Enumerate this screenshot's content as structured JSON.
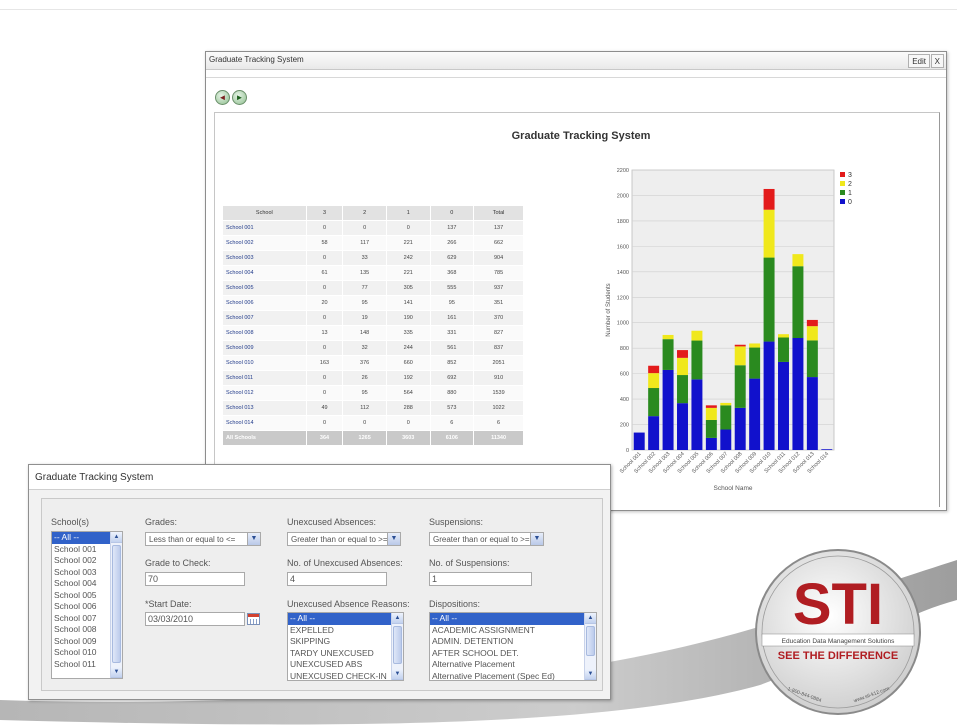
{
  "window": {
    "title": "Graduate Tracking System",
    "edit_label": "Edit",
    "close_label": "X",
    "report_title": "Graduate Tracking System"
  },
  "toolbar": {
    "icon_a": "search-back-icon",
    "icon_b": "search-export-icon"
  },
  "table": {
    "headers": [
      "School",
      "3",
      "2",
      "1",
      "0",
      "Total"
    ],
    "rows": [
      [
        "School 001",
        "0",
        "0",
        "0",
        "137",
        "137"
      ],
      [
        "School 002",
        "58",
        "117",
        "221",
        "266",
        "662"
      ],
      [
        "School 003",
        "0",
        "33",
        "242",
        "629",
        "904"
      ],
      [
        "School 004",
        "61",
        "135",
        "221",
        "368",
        "785"
      ],
      [
        "School 005",
        "0",
        "77",
        "305",
        "555",
        "937"
      ],
      [
        "School 006",
        "20",
        "95",
        "141",
        "95",
        "351"
      ],
      [
        "School 007",
        "0",
        "19",
        "190",
        "161",
        "370"
      ],
      [
        "School 008",
        "13",
        "148",
        "335",
        "331",
        "827"
      ],
      [
        "School 009",
        "0",
        "32",
        "244",
        "561",
        "837"
      ],
      [
        "School 010",
        "163",
        "376",
        "660",
        "852",
        "2051"
      ],
      [
        "School 011",
        "0",
        "26",
        "192",
        "692",
        "910"
      ],
      [
        "School 012",
        "0",
        "95",
        "564",
        "880",
        "1539"
      ],
      [
        "School 013",
        "49",
        "112",
        "288",
        "573",
        "1022"
      ],
      [
        "School 014",
        "0",
        "0",
        "0",
        "6",
        "6"
      ]
    ],
    "total_row": [
      "All Schools",
      "364",
      "1265",
      "3603",
      "6106",
      "11340"
    ]
  },
  "chart_data": {
    "type": "bar",
    "stacked": true,
    "categories": [
      "School 001",
      "School 002",
      "School 003",
      "School 004",
      "School 005",
      "School 006",
      "School 007",
      "School 008",
      "School 009",
      "School 010",
      "School 011",
      "School 012",
      "School 013",
      "School 014"
    ],
    "series": [
      {
        "name": "0",
        "color": "#1111cc",
        "values": [
          137,
          266,
          629,
          368,
          555,
          95,
          161,
          331,
          561,
          852,
          692,
          880,
          573,
          6
        ]
      },
      {
        "name": "1",
        "color": "#2a8a1f",
        "values": [
          0,
          221,
          242,
          221,
          305,
          141,
          190,
          335,
          244,
          660,
          192,
          564,
          288,
          0
        ]
      },
      {
        "name": "2",
        "color": "#f0e81c",
        "values": [
          0,
          117,
          33,
          135,
          77,
          95,
          19,
          148,
          32,
          376,
          26,
          95,
          112,
          0
        ]
      },
      {
        "name": "3",
        "color": "#e31b1b",
        "values": [
          0,
          58,
          0,
          61,
          0,
          20,
          0,
          13,
          0,
          163,
          0,
          0,
          49,
          0
        ]
      }
    ],
    "legend_order": [
      "3",
      "2",
      "1",
      "0"
    ],
    "xlabel": "School Name",
    "ylabel": "Number of Students",
    "ylim": [
      0,
      2200
    ],
    "yticks": [
      "0",
      "200",
      "400",
      "600",
      "800",
      "1000",
      "1200",
      "1400",
      "1600",
      "1800",
      "2000",
      "2200"
    ],
    "grid": true,
    "legend_position": "right"
  },
  "filters": {
    "panel_title": "Graduate Tracking System",
    "schools": {
      "label": "School(s)",
      "options": [
        "-- All --",
        "School 001",
        "School 002",
        "School 003",
        "School 004",
        "School 005",
        "School 006",
        "School 007",
        "School 008",
        "School 009",
        "School 010",
        "School 011"
      ]
    },
    "grades": {
      "label": "Grades:",
      "value": "Less than or equal to <="
    },
    "grade_to_check": {
      "label": "Grade to Check:",
      "value": "70"
    },
    "start_date": {
      "label": "*Start Date:",
      "value": "03/03/2010"
    },
    "unexcused_absences": {
      "label": "Unexcused Absences:",
      "value": "Greater than or equal to >="
    },
    "num_unexcused": {
      "label": "No. of Unexcused Absences:",
      "value": "4"
    },
    "absence_reasons": {
      "label": "Unexcused Absence Reasons:",
      "options": [
        "-- All --",
        "EXPELLED",
        "SKIPPING",
        "TARDY UNEXCUSED",
        "UNEXCUSED ABS",
        "UNEXCUSED CHECK-IN"
      ]
    },
    "suspensions": {
      "label": "Suspensions:",
      "value": "Greater than or equal to >="
    },
    "num_suspensions": {
      "label": "No. of Suspensions:",
      "value": "1"
    },
    "dispositions": {
      "label": "Dispositions:",
      "options": [
        "-- All --",
        "ACADEMIC ASSIGNMENT",
        "ADMIN. DETENTION",
        "AFTER SCHOOL DET.",
        "Alternative Placement",
        "Alternative Placement (Spec Ed)"
      ]
    }
  },
  "badge": {
    "logo_text": "STI",
    "subtitle": "Education Data Management Solutions",
    "tagline": "SEE THE DIFFERENCE",
    "phone": "1-800-844-0884",
    "website": "www.sti-k12.com",
    "accent_color": "#b01d22"
  }
}
